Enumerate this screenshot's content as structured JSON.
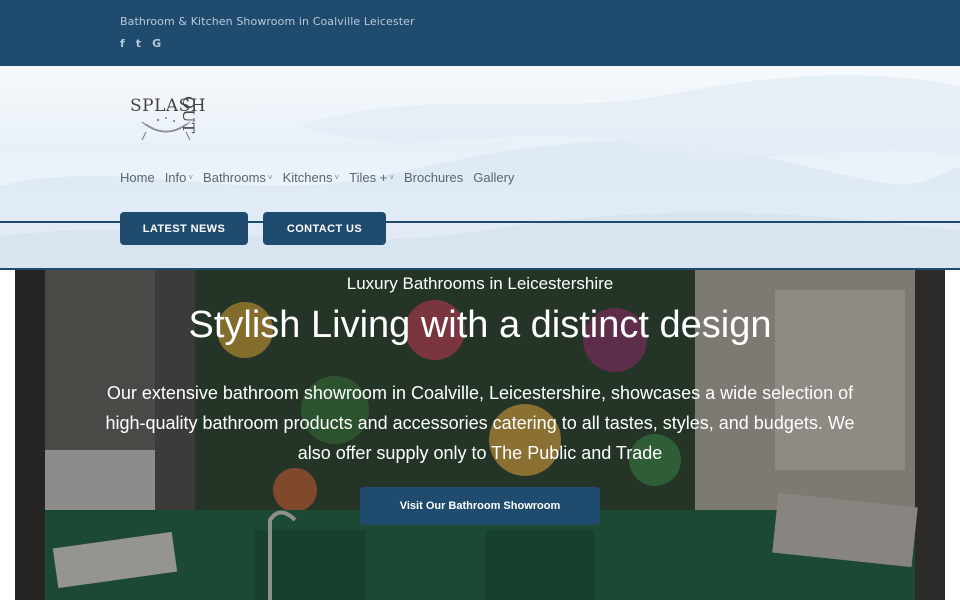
{
  "topbar": {
    "tagline": "Bathroom & Kitchen Showroom in Coalville Leicester",
    "social": [
      {
        "icon": "facebook-icon",
        "glyph": "f"
      },
      {
        "icon": "twitter-icon",
        "glyph": "t"
      },
      {
        "icon": "google-icon",
        "glyph": "G"
      }
    ]
  },
  "logo": {
    "word": "SPLASH",
    "word2": "OUT"
  },
  "nav": {
    "items": [
      {
        "label": "Home",
        "has_dropdown": false
      },
      {
        "label": "Info",
        "has_dropdown": true
      },
      {
        "label": "Bathrooms",
        "has_dropdown": true
      },
      {
        "label": "Kitchens",
        "has_dropdown": true
      },
      {
        "label": "Tiles +",
        "has_dropdown": true
      },
      {
        "label": "Brochures",
        "has_dropdown": false
      },
      {
        "label": "Gallery",
        "has_dropdown": false
      }
    ],
    "chevron": "˅"
  },
  "buttons": {
    "latest_news": "LATEST NEWS",
    "contact_us": "CONTACT US"
  },
  "hero": {
    "eyebrow": "Luxury Bathrooms in Leicestershire",
    "title": "Stylish Living with a distinct design",
    "description": "Our extensive bathroom showroom in Coalville, Leicestershire, showcases a wide selection of high-quality bathroom products and accessories catering to all tastes, styles, and budgets. We also  offer supply only to The Public and Trade",
    "cta": "Visit Our Bathroom Showroom"
  },
  "colors": {
    "brand": "#1f4b6e",
    "nav_text": "#5a6570",
    "panel_green": "#1f6a46"
  }
}
